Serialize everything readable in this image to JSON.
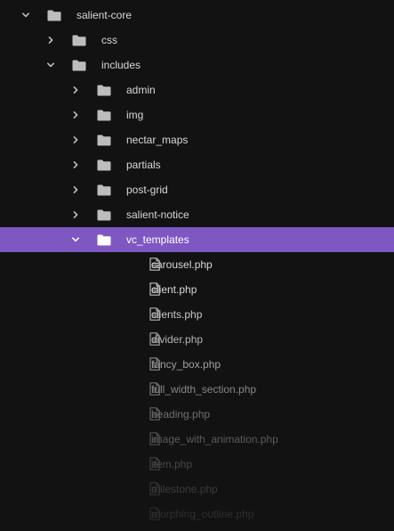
{
  "tree": {
    "items": [
      {
        "label": "salient-core",
        "kind": "folder",
        "depth": 0,
        "expanded": true,
        "selected": false,
        "fade": 1.0
      },
      {
        "label": "css",
        "kind": "folder",
        "depth": 1,
        "expanded": false,
        "selected": false,
        "fade": 1.0
      },
      {
        "label": "includes",
        "kind": "folder",
        "depth": 1,
        "expanded": true,
        "selected": false,
        "fade": 1.0
      },
      {
        "label": "admin",
        "kind": "folder",
        "depth": 2,
        "expanded": false,
        "selected": false,
        "fade": 1.0
      },
      {
        "label": "img",
        "kind": "folder",
        "depth": 2,
        "expanded": false,
        "selected": false,
        "fade": 1.0
      },
      {
        "label": "nectar_maps",
        "kind": "folder",
        "depth": 2,
        "expanded": false,
        "selected": false,
        "fade": 1.0
      },
      {
        "label": "partials",
        "kind": "folder",
        "depth": 2,
        "expanded": false,
        "selected": false,
        "fade": 1.0
      },
      {
        "label": "post-grid",
        "kind": "folder",
        "depth": 2,
        "expanded": false,
        "selected": false,
        "fade": 1.0
      },
      {
        "label": "salient-notice",
        "kind": "folder",
        "depth": 2,
        "expanded": false,
        "selected": false,
        "fade": 1.0
      },
      {
        "label": "vc_templates",
        "kind": "folder",
        "depth": 2,
        "expanded": true,
        "selected": true,
        "fade": 1.0
      },
      {
        "label": "carousel.php",
        "kind": "file",
        "depth": 3,
        "selected": false,
        "fade": 1.0
      },
      {
        "label": "client.php",
        "kind": "file",
        "depth": 3,
        "selected": false,
        "fade": 1.0
      },
      {
        "label": "clients.php",
        "kind": "file",
        "depth": 3,
        "selected": false,
        "fade": 0.92
      },
      {
        "label": "divider.php",
        "kind": "file",
        "depth": 3,
        "selected": false,
        "fade": 0.82
      },
      {
        "label": "fancy_box.php",
        "kind": "file",
        "depth": 3,
        "selected": false,
        "fade": 0.7
      },
      {
        "label": "full_width_section.php",
        "kind": "file",
        "depth": 3,
        "selected": false,
        "fade": 0.58
      },
      {
        "label": "heading.php",
        "kind": "file",
        "depth": 3,
        "selected": false,
        "fade": 0.46
      },
      {
        "label": "image_with_animation.php",
        "kind": "file",
        "depth": 3,
        "selected": false,
        "fade": 0.36
      },
      {
        "label": "item.php",
        "kind": "file",
        "depth": 3,
        "selected": false,
        "fade": 0.27
      },
      {
        "label": "milestone.php",
        "kind": "file",
        "depth": 3,
        "selected": false,
        "fade": 0.2
      },
      {
        "label": "morphing_outline.php",
        "kind": "file",
        "depth": 3,
        "selected": false,
        "fade": 0.14
      }
    ]
  },
  "colors": {
    "background": "#121212",
    "selected_row": "#7e57c2",
    "text": "#d8d8d8",
    "selected_text": "#ffffff",
    "icon": "#bdbdbd"
  },
  "icons": {
    "collapsed": "chevron-right-icon",
    "expanded": "chevron-down-icon",
    "folder": "folder-icon",
    "file": "file-icon"
  }
}
